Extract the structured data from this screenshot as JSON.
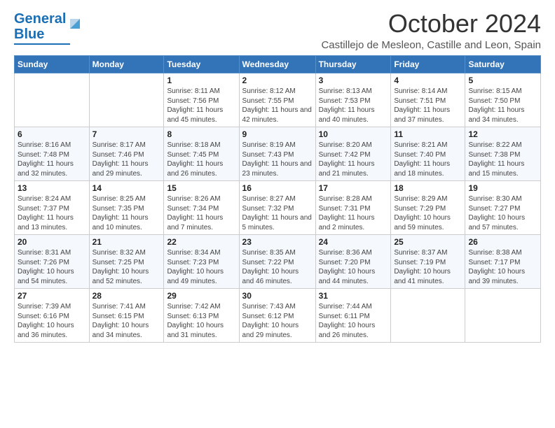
{
  "logo": {
    "line1": "General",
    "line2": "Blue"
  },
  "header": {
    "month": "October 2024",
    "location": "Castillejo de Mesleon, Castille and Leon, Spain"
  },
  "weekdays": [
    "Sunday",
    "Monday",
    "Tuesday",
    "Wednesday",
    "Thursday",
    "Friday",
    "Saturday"
  ],
  "weeks": [
    [
      {
        "day": "",
        "info": ""
      },
      {
        "day": "",
        "info": ""
      },
      {
        "day": "1",
        "info": "Sunrise: 8:11 AM\nSunset: 7:56 PM\nDaylight: 11 hours and 45 minutes."
      },
      {
        "day": "2",
        "info": "Sunrise: 8:12 AM\nSunset: 7:55 PM\nDaylight: 11 hours and 42 minutes."
      },
      {
        "day": "3",
        "info": "Sunrise: 8:13 AM\nSunset: 7:53 PM\nDaylight: 11 hours and 40 minutes."
      },
      {
        "day": "4",
        "info": "Sunrise: 8:14 AM\nSunset: 7:51 PM\nDaylight: 11 hours and 37 minutes."
      },
      {
        "day": "5",
        "info": "Sunrise: 8:15 AM\nSunset: 7:50 PM\nDaylight: 11 hours and 34 minutes."
      }
    ],
    [
      {
        "day": "6",
        "info": "Sunrise: 8:16 AM\nSunset: 7:48 PM\nDaylight: 11 hours and 32 minutes."
      },
      {
        "day": "7",
        "info": "Sunrise: 8:17 AM\nSunset: 7:46 PM\nDaylight: 11 hours and 29 minutes."
      },
      {
        "day": "8",
        "info": "Sunrise: 8:18 AM\nSunset: 7:45 PM\nDaylight: 11 hours and 26 minutes."
      },
      {
        "day": "9",
        "info": "Sunrise: 8:19 AM\nSunset: 7:43 PM\nDaylight: 11 hours and 23 minutes."
      },
      {
        "day": "10",
        "info": "Sunrise: 8:20 AM\nSunset: 7:42 PM\nDaylight: 11 hours and 21 minutes."
      },
      {
        "day": "11",
        "info": "Sunrise: 8:21 AM\nSunset: 7:40 PM\nDaylight: 11 hours and 18 minutes."
      },
      {
        "day": "12",
        "info": "Sunrise: 8:22 AM\nSunset: 7:38 PM\nDaylight: 11 hours and 15 minutes."
      }
    ],
    [
      {
        "day": "13",
        "info": "Sunrise: 8:24 AM\nSunset: 7:37 PM\nDaylight: 11 hours and 13 minutes."
      },
      {
        "day": "14",
        "info": "Sunrise: 8:25 AM\nSunset: 7:35 PM\nDaylight: 11 hours and 10 minutes."
      },
      {
        "day": "15",
        "info": "Sunrise: 8:26 AM\nSunset: 7:34 PM\nDaylight: 11 hours and 7 minutes."
      },
      {
        "day": "16",
        "info": "Sunrise: 8:27 AM\nSunset: 7:32 PM\nDaylight: 11 hours and 5 minutes."
      },
      {
        "day": "17",
        "info": "Sunrise: 8:28 AM\nSunset: 7:31 PM\nDaylight: 11 hours and 2 minutes."
      },
      {
        "day": "18",
        "info": "Sunrise: 8:29 AM\nSunset: 7:29 PM\nDaylight: 10 hours and 59 minutes."
      },
      {
        "day": "19",
        "info": "Sunrise: 8:30 AM\nSunset: 7:27 PM\nDaylight: 10 hours and 57 minutes."
      }
    ],
    [
      {
        "day": "20",
        "info": "Sunrise: 8:31 AM\nSunset: 7:26 PM\nDaylight: 10 hours and 54 minutes."
      },
      {
        "day": "21",
        "info": "Sunrise: 8:32 AM\nSunset: 7:25 PM\nDaylight: 10 hours and 52 minutes."
      },
      {
        "day": "22",
        "info": "Sunrise: 8:34 AM\nSunset: 7:23 PM\nDaylight: 10 hours and 49 minutes."
      },
      {
        "day": "23",
        "info": "Sunrise: 8:35 AM\nSunset: 7:22 PM\nDaylight: 10 hours and 46 minutes."
      },
      {
        "day": "24",
        "info": "Sunrise: 8:36 AM\nSunset: 7:20 PM\nDaylight: 10 hours and 44 minutes."
      },
      {
        "day": "25",
        "info": "Sunrise: 8:37 AM\nSunset: 7:19 PM\nDaylight: 10 hours and 41 minutes."
      },
      {
        "day": "26",
        "info": "Sunrise: 8:38 AM\nSunset: 7:17 PM\nDaylight: 10 hours and 39 minutes."
      }
    ],
    [
      {
        "day": "27",
        "info": "Sunrise: 7:39 AM\nSunset: 6:16 PM\nDaylight: 10 hours and 36 minutes."
      },
      {
        "day": "28",
        "info": "Sunrise: 7:41 AM\nSunset: 6:15 PM\nDaylight: 10 hours and 34 minutes."
      },
      {
        "day": "29",
        "info": "Sunrise: 7:42 AM\nSunset: 6:13 PM\nDaylight: 10 hours and 31 minutes."
      },
      {
        "day": "30",
        "info": "Sunrise: 7:43 AM\nSunset: 6:12 PM\nDaylight: 10 hours and 29 minutes."
      },
      {
        "day": "31",
        "info": "Sunrise: 7:44 AM\nSunset: 6:11 PM\nDaylight: 10 hours and 26 minutes."
      },
      {
        "day": "",
        "info": ""
      },
      {
        "day": "",
        "info": ""
      }
    ]
  ]
}
